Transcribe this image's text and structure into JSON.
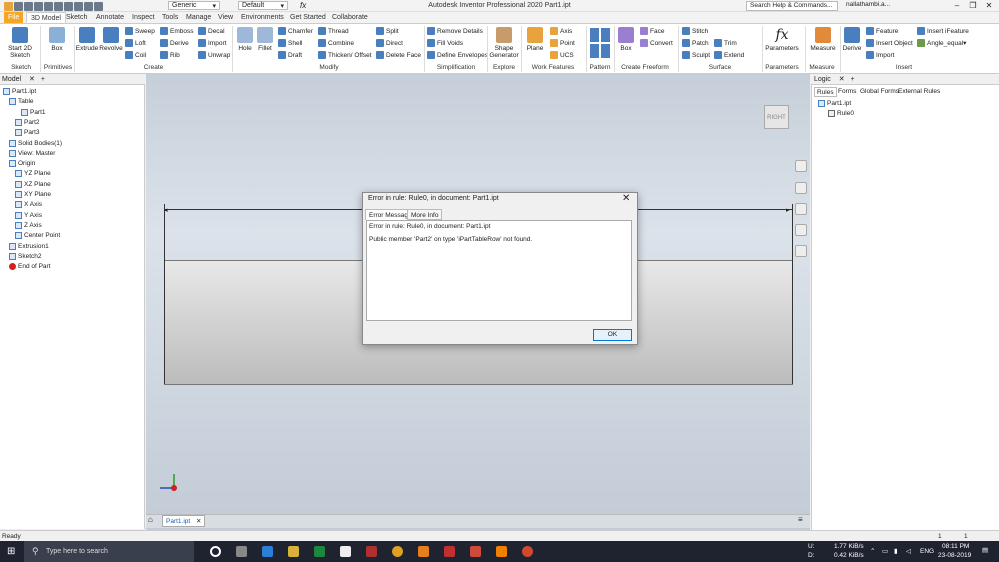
{
  "app": {
    "window_title": "Autodesk Inventor Professional 2020    Part1.ipt",
    "style_dropdown": "Generic",
    "appearance_dropdown": "Default",
    "help_search_placeholder": "Search Help & Commands...",
    "user": "nallathambi.a...",
    "ribbon_tabs": [
      "File",
      "3D Model",
      "Sketch",
      "Annotate",
      "Inspect",
      "Tools",
      "Manage",
      "View",
      "Environments",
      "Get Started",
      "Collaborate"
    ]
  },
  "ribbon": {
    "sketch": {
      "start_sketch": "Start 2D Sketch",
      "group": "Sketch"
    },
    "primitives": {
      "box": "Box",
      "group": "Primitives"
    },
    "create": {
      "extrude": "Extrude",
      "revolve": "Revolve",
      "sweep": "Sweep",
      "loft": "Loft",
      "coil": "Coil",
      "emboss": "Emboss",
      "derive": "Derive",
      "rib": "Rib",
      "decal": "Decal",
      "import": "Import",
      "unwrap": "Unwrap",
      "group": "Create"
    },
    "modify": {
      "hole": "Hole",
      "fillet": "Fillet",
      "chamfer": "Chamfer",
      "shell": "Shell",
      "draft": "Draft",
      "thread": "Thread",
      "combine": "Combine",
      "thicken": "Thicken/ Offset",
      "split": "Split",
      "direct": "Direct",
      "delete_face": "Delete Face",
      "group": "Modify"
    },
    "simplification": {
      "remove_details": "Remove Details",
      "fill_voids": "Fill Voids",
      "define_envelopes": "Define Envelopes",
      "group": "Simplification"
    },
    "explore": {
      "shape_generator": "Shape Generator",
      "group": "Explore"
    },
    "work_features": {
      "plane": "Plane",
      "axis": "Axis",
      "point": "Point",
      "ucs": "UCS",
      "group": "Work Features"
    },
    "pattern": {
      "group": "Pattern"
    },
    "freeform": {
      "box": "Box",
      "face": "Face",
      "convert": "Convert",
      "group": "Create Freeform"
    },
    "surface": {
      "stitch": "Stitch",
      "patch": "Patch",
      "sculpt": "Sculpt",
      "trim": "Trim",
      "extend": "Extend",
      "group": "Surface"
    },
    "parameters": {
      "label": "Parameters",
      "group": "Parameters"
    },
    "measure": {
      "label": "Measure",
      "group": "Measure"
    },
    "insert": {
      "derive": "Derive",
      "feature": "Feature",
      "insert_object": "Insert Object",
      "import": "Import",
      "insert_ifeature": "Insert iFeature",
      "angle_equal": "Angle_equal",
      "group": "Insert"
    }
  },
  "model_browser": {
    "title": "Model",
    "items": [
      {
        "label": "Part1.ipt",
        "indent": 0
      },
      {
        "label": "Table",
        "indent": 1
      },
      {
        "label": "Part1",
        "indent": 3
      },
      {
        "label": "Part2",
        "indent": 2
      },
      {
        "label": "Part3",
        "indent": 2
      },
      {
        "label": "Solid Bodies(1)",
        "indent": 1
      },
      {
        "label": "View: Master",
        "indent": 1
      },
      {
        "label": "Origin",
        "indent": 1
      },
      {
        "label": "YZ Plane",
        "indent": 2
      },
      {
        "label": "XZ Plane",
        "indent": 2
      },
      {
        "label": "XY Plane",
        "indent": 2
      },
      {
        "label": "X Axis",
        "indent": 2
      },
      {
        "label": "Y Axis",
        "indent": 2
      },
      {
        "label": "Z Axis",
        "indent": 2
      },
      {
        "label": "Center Point",
        "indent": 2
      },
      {
        "label": "Extrusion1",
        "indent": 1
      },
      {
        "label": "Sketch2",
        "indent": 1
      },
      {
        "label": "End of Part",
        "indent": 1
      }
    ]
  },
  "viewport": {
    "viewcube_label": "RIGHT",
    "doc_tab": "Part1.ipt"
  },
  "logic": {
    "title": "Logic",
    "tabs": [
      "Rules",
      "Forms",
      "Global Forms",
      "External Rules"
    ],
    "tree": [
      "Part1.ipt",
      "Rule0"
    ]
  },
  "dialog": {
    "title": "Error in rule: Rule0, in document: Part1.ipt",
    "tabs": [
      "Error Message",
      "More Info"
    ],
    "line1": "Error in rule: Rule0, in document: Part1.ipt",
    "line2": "Public member 'Part2' on type 'iPartTableRow' not found.",
    "ok": "OK"
  },
  "status": {
    "text": "Ready",
    "count1": "1",
    "count2": "1"
  },
  "taskbar": {
    "search_placeholder": "Type here to search",
    "net_up_label": "U:",
    "net_up": "1.77 KiB/s",
    "net_down_label": "D:",
    "net_down": "0.42 KiB/s",
    "lang": "ENG",
    "time": "08:11 PM",
    "date": "23-08-2019"
  }
}
